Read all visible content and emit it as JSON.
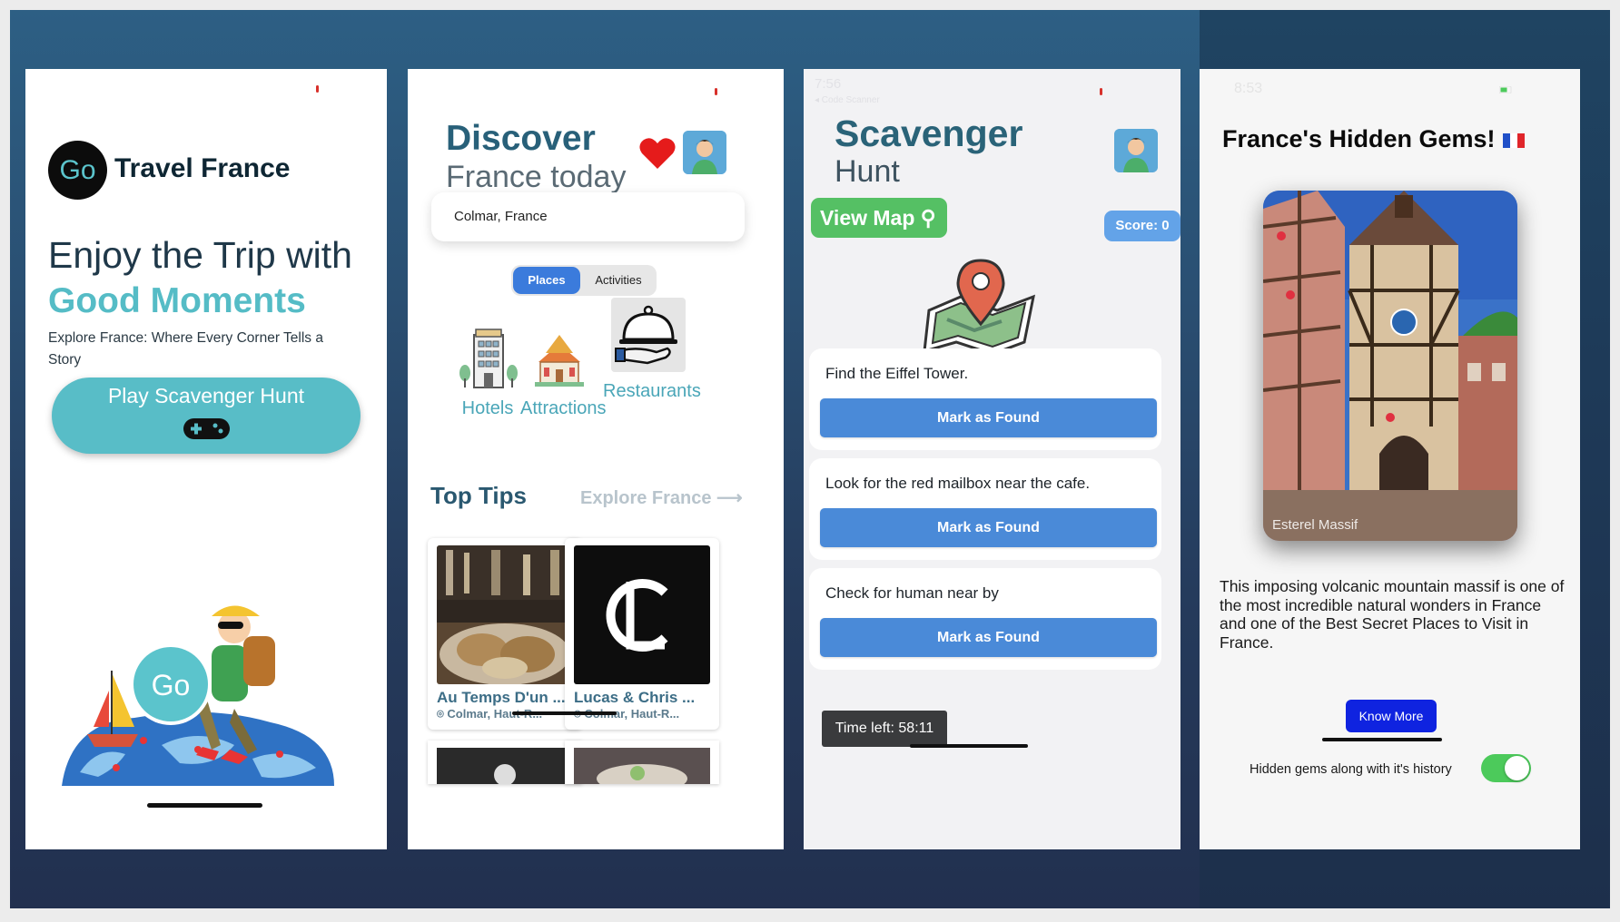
{
  "screen1": {
    "logo_text": "Go",
    "brand_title": "Travel France",
    "hero_line1": "Enjoy the Trip with",
    "hero_line2": "Good Moments",
    "subtitle": "Explore France: Where Every Corner Tells a Story",
    "play_button": "Play Scavenger Hunt",
    "illustration_badge": "Go",
    "icons": [
      "gamepad-icon"
    ]
  },
  "screen2": {
    "title": "Discover",
    "subtitle": "France today",
    "location_value": "Colmar, France",
    "tabs": [
      {
        "label": "Places",
        "active": true
      },
      {
        "label": "Activities",
        "active": false
      }
    ],
    "categories": [
      {
        "label": "Hotels",
        "icon": "hotel-icon"
      },
      {
        "label": "Attractions",
        "icon": "temple-icon"
      },
      {
        "label": "Restaurants",
        "icon": "cloche-icon"
      }
    ],
    "top_tips": "Top Tips",
    "explore_link": "Explore France ⟶",
    "cards": [
      {
        "name": "Au Temps D'un ...",
        "location": "Colmar, Haut-R..."
      },
      {
        "name": "Lucas & Chris ...",
        "location": "Colmar, Haut-R..."
      }
    ],
    "colors": {
      "accent": "#3b7bdc",
      "title": "#286079",
      "category": "#4aa6b8"
    }
  },
  "screen3": {
    "status_time": "7:56",
    "status_back": "◂ Code Scanner",
    "title1": "Scavenger",
    "title2": "Hunt",
    "view_map": "View Map",
    "score": "Score: 0",
    "tasks": [
      {
        "text": "Find the Eiffel Tower.",
        "button": "Mark as Found"
      },
      {
        "text": "Look for the red mailbox near the cafe.",
        "button": "Mark as Found"
      },
      {
        "text": "Check for human near by",
        "button": "Mark as Found"
      }
    ],
    "timer": "Time left: 58:11",
    "colors": {
      "view_map": "#55c064",
      "button": "#4a8ad8",
      "score": "#63a3e8"
    }
  },
  "screen4": {
    "status_time": "8:53",
    "title": "France's Hidden Gems!",
    "photo_caption": "Esterel Massif",
    "description": "This imposing volcanic mountain massif is one of the most incredible natural wonders in France and one of the Best Secret Places to Visit in France.",
    "know_more": "Know More",
    "toggle_label": "Hidden gems along with it's history",
    "toggle_on": true,
    "colors": {
      "know_more": "#0f23e0",
      "toggle": "#4cca5b"
    }
  }
}
